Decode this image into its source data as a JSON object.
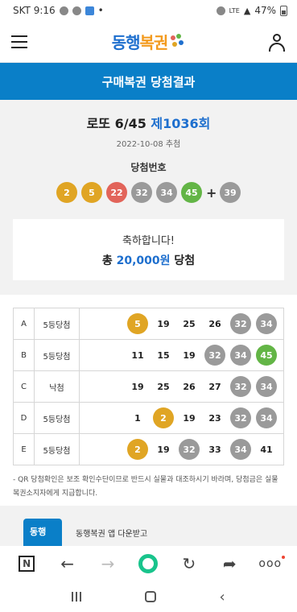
{
  "status_bar": {
    "carrier_time": "SKT 9:16",
    "network": "LTE",
    "battery": "47%",
    "dot": "•"
  },
  "header": {
    "logo_part1": "동행",
    "logo_part2": "복권",
    "menu_icon": "hamburger-icon",
    "user_icon": "user-icon"
  },
  "title": "구매복권 당첨결과",
  "draw": {
    "game": "로또 6/45",
    "round": "제1036회",
    "date": "2022-10-08 추첨",
    "win_label": "당첨번호",
    "numbers": [
      {
        "n": "2",
        "color": "#e0a524"
      },
      {
        "n": "5",
        "color": "#e0a524"
      },
      {
        "n": "22",
        "color": "#e2645a"
      },
      {
        "n": "32",
        "color": "#9a9a9a"
      },
      {
        "n": "34",
        "color": "#9a9a9a"
      },
      {
        "n": "45",
        "color": "#63b546"
      }
    ],
    "plus": "+",
    "bonus": {
      "n": "39",
      "color": "#9a9a9a"
    }
  },
  "prize": {
    "congrats": "축하합니다!",
    "total_prefix": "총",
    "amount": "20,000원",
    "total_suffix": "당첨"
  },
  "rows": [
    {
      "label": "A",
      "result": "5등당첨",
      "nums": [
        {
          "n": "5",
          "hit": true,
          "color": "#e0a524"
        },
        {
          "n": "19",
          "hit": false
        },
        {
          "n": "25",
          "hit": false
        },
        {
          "n": "26",
          "hit": false
        },
        {
          "n": "32",
          "hit": true,
          "color": "#9a9a9a"
        },
        {
          "n": "34",
          "hit": true,
          "color": "#9a9a9a"
        }
      ]
    },
    {
      "label": "B",
      "result": "5등당첨",
      "nums": [
        {
          "n": "11",
          "hit": false
        },
        {
          "n": "15",
          "hit": false
        },
        {
          "n": "19",
          "hit": false
        },
        {
          "n": "32",
          "hit": true,
          "color": "#9a9a9a"
        },
        {
          "n": "34",
          "hit": true,
          "color": "#9a9a9a"
        },
        {
          "n": "45",
          "hit": true,
          "color": "#63b546"
        }
      ]
    },
    {
      "label": "C",
      "result": "낙첨",
      "nums": [
        {
          "n": "19",
          "hit": false
        },
        {
          "n": "25",
          "hit": false
        },
        {
          "n": "26",
          "hit": false
        },
        {
          "n": "27",
          "hit": false
        },
        {
          "n": "32",
          "hit": true,
          "color": "#9a9a9a"
        },
        {
          "n": "34",
          "hit": true,
          "color": "#9a9a9a"
        }
      ]
    },
    {
      "label": "D",
      "result": "5등당첨",
      "nums": [
        {
          "n": "1",
          "hit": false
        },
        {
          "n": "2",
          "hit": true,
          "color": "#e0a524"
        },
        {
          "n": "19",
          "hit": false
        },
        {
          "n": "23",
          "hit": false
        },
        {
          "n": "32",
          "hit": true,
          "color": "#9a9a9a"
        },
        {
          "n": "34",
          "hit": true,
          "color": "#9a9a9a"
        }
      ]
    },
    {
      "label": "E",
      "result": "5등당첨",
      "nums": [
        {
          "n": "2",
          "hit": true,
          "color": "#e0a524"
        },
        {
          "n": "19",
          "hit": false
        },
        {
          "n": "32",
          "hit": true,
          "color": "#9a9a9a"
        },
        {
          "n": "33",
          "hit": false
        },
        {
          "n": "34",
          "hit": true,
          "color": "#9a9a9a"
        },
        {
          "n": "41",
          "hit": false
        }
      ]
    }
  ],
  "note": "- QR 당첨확인은 보조 확인수단이므로 반드시 실물과 대조하시기 바라며, 당첨금은 실물복권소지자에게 지급합니다.",
  "app": {
    "icon_text": "동행",
    "text": "동행복권 앱 다운받고"
  },
  "browser_bar": {
    "n_label": "N",
    "more": "ooo"
  }
}
